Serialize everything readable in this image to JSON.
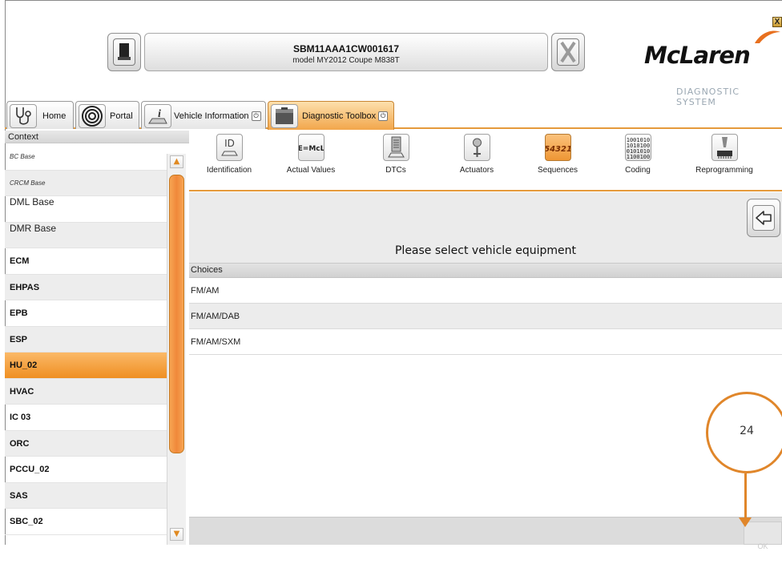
{
  "window": {
    "close_label": "X"
  },
  "header": {
    "vin": "SBM11AAA1CW001617",
    "model": "model MY2012 Coupe M838T",
    "logo_text": "McLaren",
    "logo_subtitle": "DIAGNOSTIC SYSTEM",
    "left_button_icon": "device-icon",
    "right_button_icon": "x-icon"
  },
  "tabs": [
    {
      "label": "Home",
      "icon": "stethoscope-icon"
    },
    {
      "label": "Portal",
      "icon": "spiral-icon"
    },
    {
      "label": "Vehicle Information",
      "icon": "info-car-icon"
    },
    {
      "label": "Diagnostic Toolbox",
      "icon": "toolbox-icon"
    }
  ],
  "context": {
    "header": "Context",
    "items": [
      "BC Base",
      "CRCM Base",
      "DML Base",
      "DMR Base",
      "ECM",
      "EHPAS",
      "EPB",
      "ESP",
      "HU_02",
      "HVAC",
      "IC 03",
      "ORC",
      "PCCU_02",
      "SAS",
      "SBC_02"
    ],
    "selected": "HU_02"
  },
  "tools": [
    {
      "label": "Identification",
      "icon": "id-car-icon",
      "glyph": "ID"
    },
    {
      "label": "Actual Values",
      "icon": "emcl-icon",
      "glyph": "E=McL"
    },
    {
      "label": "DTCs",
      "icon": "document-car-icon",
      "glyph": ""
    },
    {
      "label": "Actuators",
      "icon": "actuator-icon",
      "glyph": ""
    },
    {
      "label": "Sequences",
      "icon": "sequence-icon",
      "glyph": "54321"
    },
    {
      "label": "Coding",
      "icon": "binary-code-icon",
      "glyph": "1001010"
    },
    {
      "label": "Reprogramming",
      "icon": "chip-icon",
      "glyph": ""
    }
  ],
  "main": {
    "prompt": "Please select vehicle equipment",
    "choices_header": "Choices",
    "choices": [
      "FM/AM",
      "FM/AM/DAB",
      "FM/AM/SXM"
    ],
    "ok_label": "OK"
  },
  "callout": {
    "number": "24",
    "color": "#e0862a"
  },
  "colors": {
    "accent": "#f0953a",
    "selected_row": "#ef8f22"
  }
}
